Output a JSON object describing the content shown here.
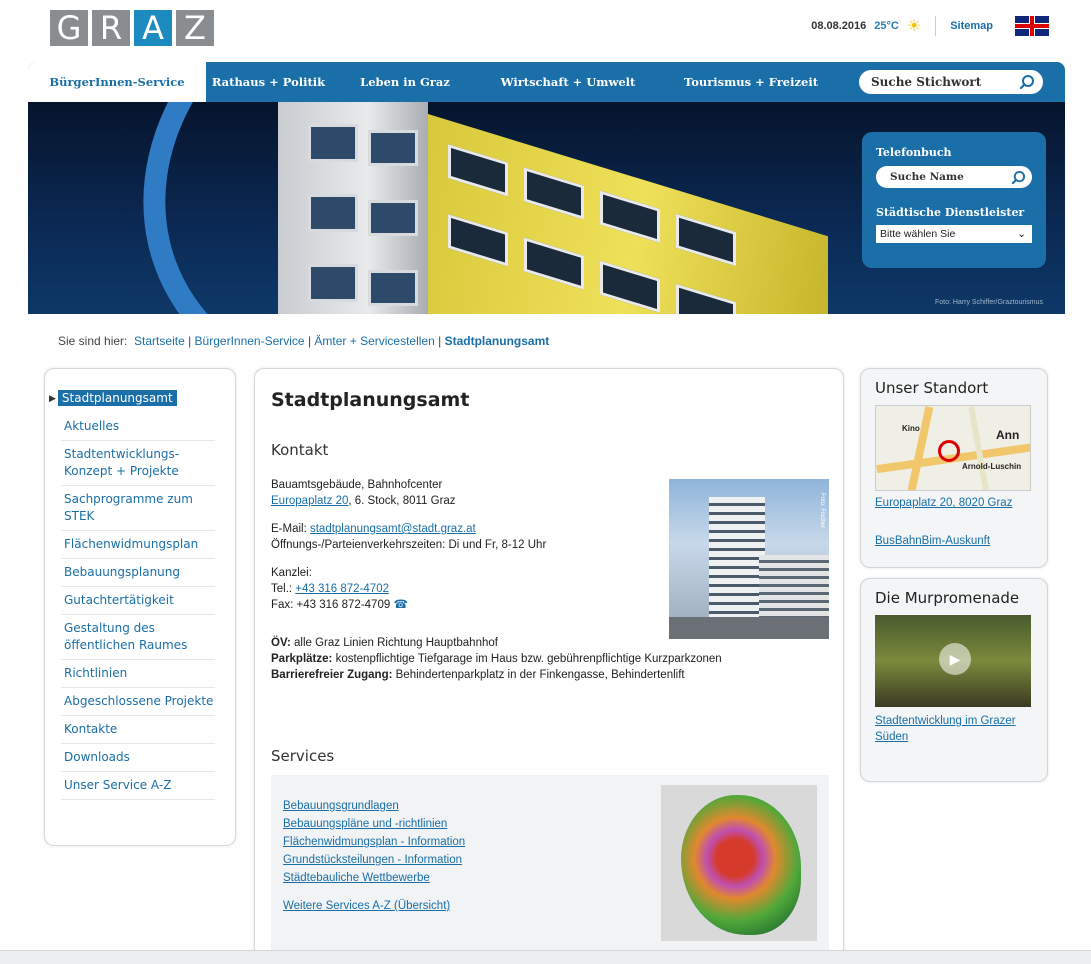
{
  "logo": {
    "letters": [
      "G",
      "R",
      "A",
      "Z"
    ]
  },
  "topbar": {
    "date": "08.08.2016",
    "temperature": "25°C",
    "weather_icon": "sun-icon",
    "sitemap": "Sitemap",
    "language_icon": "uk-flag-icon"
  },
  "nav": {
    "tabs": [
      {
        "label": "BürgerInnen-Service",
        "active": true
      },
      {
        "label": "Rathaus + Politik"
      },
      {
        "label": "Leben in Graz"
      },
      {
        "label": "Wirtschaft + Umwelt"
      },
      {
        "label": "Tourismus + Freizeit"
      }
    ],
    "search_placeholder": "Suche Stichwort"
  },
  "hero": {
    "credit": "Foto: Harry Schiffer/Graztourismus",
    "phonebook_label": "Telefonbuch",
    "phonebook_placeholder": "Suche Name",
    "services_label": "Städtische Dienstleister",
    "services_select": "Bitte wählen Sie"
  },
  "breadcrumb": {
    "prefix": "Sie sind hier:",
    "items": [
      "Startseite",
      "BürgerInnen-Service",
      "Ämter + Servicestellen"
    ],
    "current": "Stadtplanungsamt"
  },
  "sidebar": {
    "active": "Stadtplanungsamt",
    "items": [
      "Aktuelles",
      "Stadtentwicklungs-Konzept + Projekte",
      "Sachprogramme zum STEK",
      "Flächenwidmungsplan",
      "Bebauungsplanung",
      "Gutachtertätigkeit",
      "Gestaltung des öffentlichen Raumes",
      "Richtlinien",
      "Abgeschlossene Projekte",
      "Kontakte",
      "Downloads",
      "Unser Service A-Z"
    ]
  },
  "main": {
    "title": "Stadtplanungsamt",
    "contact_heading": "Kontakt",
    "building": "Bauamtsgebäude, Bahnhofcenter",
    "address_link": "Europaplatz 20",
    "address_rest": ", 6. Stock, 8011 Graz",
    "email_label": "E-Mail:",
    "email": "stadtplanungsamt@stadt.graz.at",
    "hours": "Öffnungs-/Parteienverkehrszeiten: Di und Fr, 8-12 Uhr",
    "office_label": "Kanzlei:",
    "tel_label": "Tel.:",
    "tel": "+43 316 872-4702",
    "fax": "Fax: +43 316 872-4709",
    "photo_caption": "Foto: Fischer",
    "ov_label": "ÖV:",
    "ov_text": "alle Graz Linien Richtung Hauptbahnhof",
    "parking_label": "Parkplätze:",
    "parking_text": "kostenpflichtige Tiefgarage im Haus bzw. gebührenpflichtige Kurzparkzonen",
    "access_label": "Barrierefreier Zugang:",
    "access_text": "Behindertenparkplatz in der Finkengasse, Behindertenlift",
    "services_heading": "Services",
    "services_links": [
      "Bebauungsgrundlagen",
      "Bebauungspläne und -richtlinien",
      "Flächenwidmungsplan - Information",
      "Grundstücksteilungen - Information",
      "Städtebauliche Wettbewerbe"
    ],
    "services_more": "Weitere Services A-Z (Übersicht)"
  },
  "right": {
    "location_title": "Unser Standort",
    "location_link": "Europaplatz 20, 8020 Graz",
    "transit_link": "BusBahnBim-Auskunft",
    "map_labels": [
      "Kino",
      "Ann",
      "Arnold-Luschin"
    ],
    "mur_title": "Die Murpromenade",
    "mur_link": "Stadtentwicklung im Grazer Süden"
  }
}
